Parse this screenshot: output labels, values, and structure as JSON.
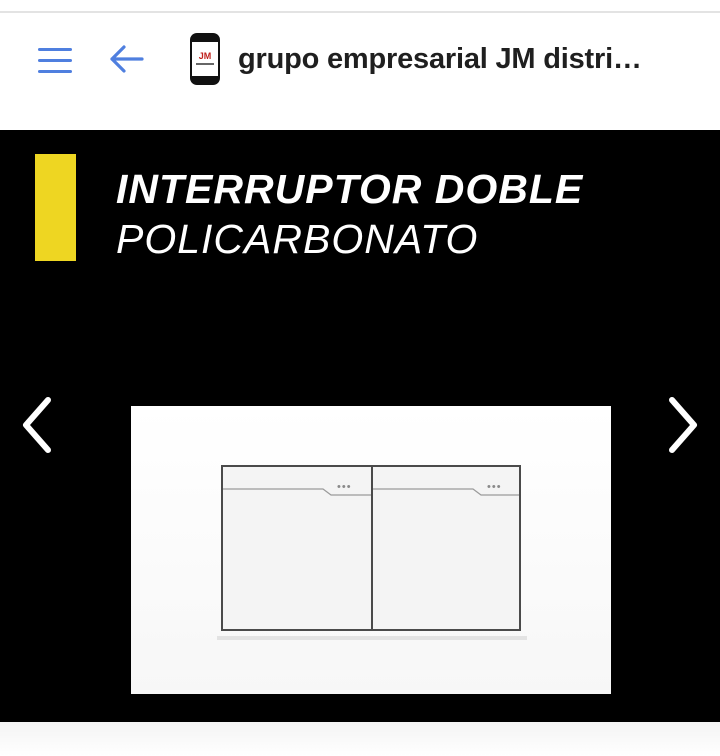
{
  "header": {
    "title": "grupo empresarial JM distri…",
    "menu_icon": "hamburger-menu-icon",
    "back_icon": "arrow-left-icon",
    "logo_text": "JM",
    "accent": "#4f7fdf"
  },
  "banner": {
    "heading_line1": "INTERRUPTOR DOBLE",
    "heading_line2": "POLICARBONATO",
    "accent_color": "#eed622",
    "prev_icon": "chevron-left-icon",
    "next_icon": "chevron-right-icon"
  }
}
